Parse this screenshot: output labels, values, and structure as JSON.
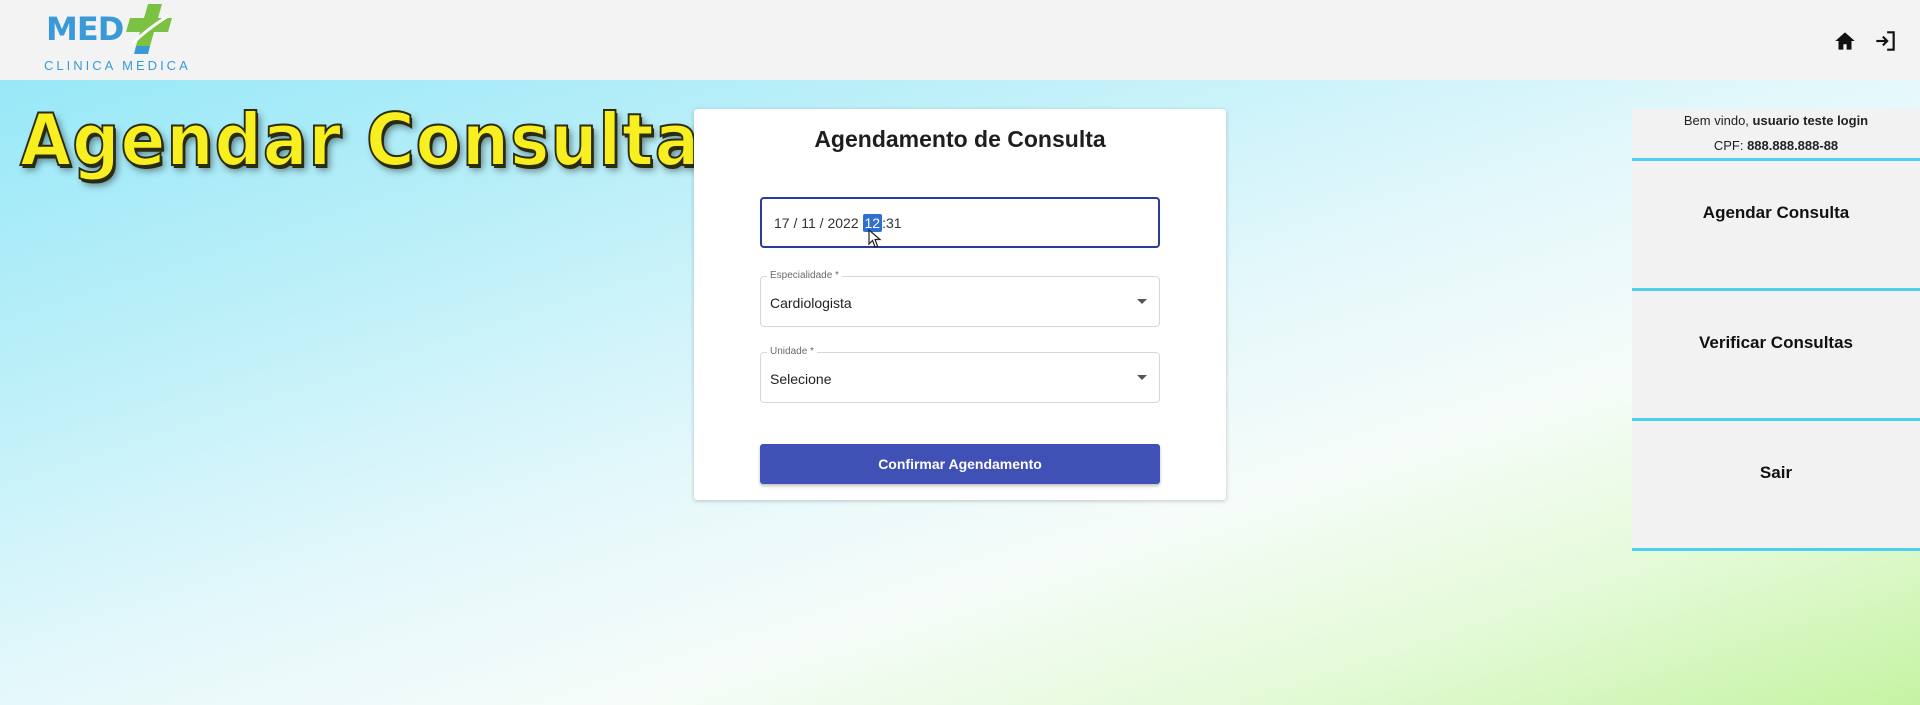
{
  "header": {
    "logo_text": "MED",
    "logo_subtitle": "CLINICA MEDICA",
    "home_icon": "home-icon",
    "logout_icon": "logout-icon"
  },
  "overlay_title": "Agendar Consultas",
  "form": {
    "title": "Agendamento de Consulta",
    "datetime": {
      "day": "17",
      "month": "11",
      "year": "2022",
      "hour": "12",
      "minute": "31"
    },
    "especialidade": {
      "label": "Especialidade *",
      "value": "Cardiologista"
    },
    "unidade": {
      "label": "Unidade *",
      "value": "Selecione"
    },
    "confirm_label": "Confirmar Agendamento"
  },
  "sidebar": {
    "welcome_prefix": "Bem vindo,",
    "user_name": "usuario teste login",
    "cpf_label": "CPF:",
    "cpf_value": "888.888.888-88",
    "items": [
      {
        "label": "Agendar Consulta"
      },
      {
        "label": "Verificar Consultas"
      },
      {
        "label": "Sair"
      }
    ]
  },
  "colors": {
    "accent": "#3f51b5",
    "divider": "#4dd0ee",
    "title_yellow": "#f7ef1f",
    "logo_blue": "#3a9ad8",
    "logo_green": "#7cc242"
  }
}
